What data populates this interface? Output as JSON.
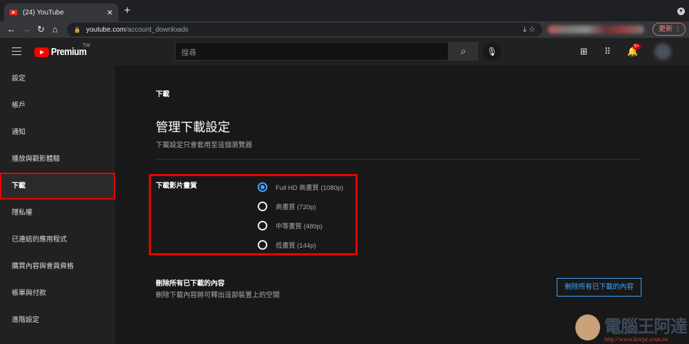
{
  "browser": {
    "tab_title": "(24) YouTube",
    "url_domain": "youtube.com",
    "url_path": "/account_downloads",
    "update_label": "更新"
  },
  "header": {
    "logo_text": "Premium",
    "region": "TW",
    "search_placeholder": "搜尋",
    "notification_count": "9+"
  },
  "sidebar": {
    "items": [
      {
        "label": "設定"
      },
      {
        "label": "帳戶"
      },
      {
        "label": "通知"
      },
      {
        "label": "播放與觀影體驗"
      },
      {
        "label": "下載",
        "active": true
      },
      {
        "label": "隱私權"
      },
      {
        "label": "已連結的應用程式"
      },
      {
        "label": "購買內容與會員資格"
      },
      {
        "label": "帳單與付款"
      },
      {
        "label": "進階設定"
      }
    ]
  },
  "main": {
    "breadcrumb": "下載",
    "title": "管理下載設定",
    "subtitle": "下載設定只會套用至這個瀏覽器",
    "quality": {
      "label": "下載影片畫質",
      "options": [
        {
          "label": "Full HD 高畫質 (1080p)",
          "selected": true
        },
        {
          "label": "高畫質 (720p)",
          "selected": false
        },
        {
          "label": "中等畫質 (480p)",
          "selected": false
        },
        {
          "label": "低畫質 (144p)",
          "selected": false
        }
      ]
    },
    "delete": {
      "title": "刪除所有已下載的內容",
      "description": "刪除下載內容將可釋出這部裝置上的空間",
      "button": "刪除所有已下載的內容"
    }
  },
  "watermark": {
    "name": "電腦王阿達",
    "url": "http://www.kocpc.com.tw"
  },
  "colors": {
    "accent": "#3ea6ff",
    "highlight": "#ee0000"
  }
}
